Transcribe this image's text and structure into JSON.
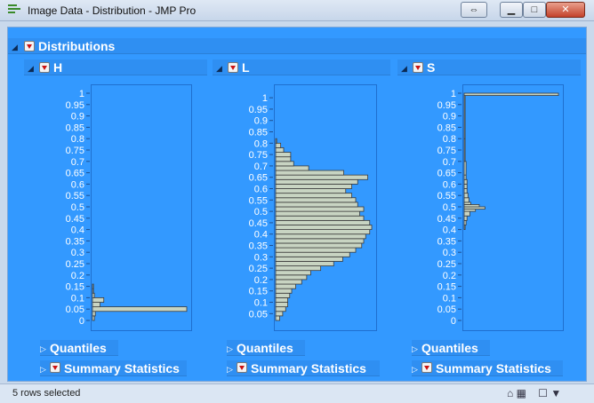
{
  "window": {
    "title": "Image Data - Distribution - JMP Pro",
    "buttons": {
      "back": "⇔",
      "minimize": "▁",
      "maximize": "□",
      "close": "✕"
    }
  },
  "report": {
    "title": "Distributions",
    "panels": [
      {
        "name": "H",
        "axis_ticks": [
          "1",
          "0.95",
          "0.9",
          "0.85",
          "0.8",
          "0.75",
          "0.7",
          "0.65",
          "0.6",
          "0.55",
          "0.5",
          "0.45",
          "0.4",
          "0.35",
          "0.3",
          "0.25",
          "0.2",
          "0.15",
          "0.1",
          "0.05",
          "0"
        ],
        "outline_quantiles": "Quantiles",
        "outline_summary": "Summary Statistics"
      },
      {
        "name": "L",
        "axis_ticks": [
          "1",
          "0.95",
          "0.9",
          "0.85",
          "0.8",
          "0.75",
          "0.7",
          "0.65",
          "0.6",
          "0.55",
          "0.5",
          "0.45",
          "0.4",
          "0.35",
          "0.3",
          "0.25",
          "0.2",
          "0.15",
          "0.1",
          "0.05"
        ],
        "outline_quantiles": "Quantiles",
        "outline_summary": "Summary Statistics"
      },
      {
        "name": "S",
        "axis_ticks": [
          "1",
          "0.95",
          "0.9",
          "0.85",
          "0.8",
          "0.75",
          "0.7",
          "0.65",
          "0.6",
          "0.55",
          "0.5",
          "0.45",
          "0.4",
          "0.35",
          "0.3",
          "0.25",
          "0.2",
          "0.15",
          "0.1",
          "0.05",
          "0"
        ],
        "outline_quantiles": "Quantiles",
        "outline_summary": "Summary Statistics"
      }
    ]
  },
  "chart_data": [
    {
      "type": "bar",
      "orientation": "horizontal-histogram",
      "title": "H",
      "bins": [
        {
          "from": 0.0,
          "to": 0.02,
          "count": 2
        },
        {
          "from": 0.02,
          "to": 0.04,
          "count": 3
        },
        {
          "from": 0.04,
          "to": 0.06,
          "count": 100
        },
        {
          "from": 0.06,
          "to": 0.08,
          "count": 8
        },
        {
          "from": 0.08,
          "to": 0.1,
          "count": 12
        },
        {
          "from": 0.1,
          "to": 0.12,
          "count": 2
        },
        {
          "from": 0.12,
          "to": 0.14,
          "count": 1
        },
        {
          "from": 0.14,
          "to": 0.16,
          "count": 1
        }
      ],
      "ylim": [
        0,
        1
      ]
    },
    {
      "type": "bar",
      "orientation": "horizontal-histogram",
      "title": "L",
      "bins": [
        {
          "from": 0.02,
          "to": 0.04,
          "count": 4
        },
        {
          "from": 0.04,
          "to": 0.06,
          "count": 7
        },
        {
          "from": 0.06,
          "to": 0.08,
          "count": 10
        },
        {
          "from": 0.08,
          "to": 0.1,
          "count": 12
        },
        {
          "from": 0.1,
          "to": 0.12,
          "count": 12
        },
        {
          "from": 0.12,
          "to": 0.14,
          "count": 14
        },
        {
          "from": 0.14,
          "to": 0.16,
          "count": 16
        },
        {
          "from": 0.16,
          "to": 0.18,
          "count": 20
        },
        {
          "from": 0.18,
          "to": 0.2,
          "count": 26
        },
        {
          "from": 0.2,
          "to": 0.22,
          "count": 31
        },
        {
          "from": 0.22,
          "to": 0.24,
          "count": 35
        },
        {
          "from": 0.24,
          "to": 0.26,
          "count": 45
        },
        {
          "from": 0.26,
          "to": 0.28,
          "count": 58
        },
        {
          "from": 0.28,
          "to": 0.3,
          "count": 67
        },
        {
          "from": 0.3,
          "to": 0.32,
          "count": 74
        },
        {
          "from": 0.32,
          "to": 0.34,
          "count": 80
        },
        {
          "from": 0.34,
          "to": 0.36,
          "count": 86
        },
        {
          "from": 0.36,
          "to": 0.38,
          "count": 88
        },
        {
          "from": 0.38,
          "to": 0.4,
          "count": 90
        },
        {
          "from": 0.4,
          "to": 0.42,
          "count": 94
        },
        {
          "from": 0.42,
          "to": 0.44,
          "count": 96
        },
        {
          "from": 0.44,
          "to": 0.46,
          "count": 94
        },
        {
          "from": 0.46,
          "to": 0.48,
          "count": 88
        },
        {
          "from": 0.48,
          "to": 0.5,
          "count": 84
        },
        {
          "from": 0.5,
          "to": 0.52,
          "count": 88
        },
        {
          "from": 0.52,
          "to": 0.54,
          "count": 82
        },
        {
          "from": 0.54,
          "to": 0.56,
          "count": 80
        },
        {
          "from": 0.56,
          "to": 0.58,
          "count": 76
        },
        {
          "from": 0.58,
          "to": 0.6,
          "count": 70
        },
        {
          "from": 0.6,
          "to": 0.62,
          "count": 76
        },
        {
          "from": 0.62,
          "to": 0.64,
          "count": 82
        },
        {
          "from": 0.64,
          "to": 0.66,
          "count": 92
        },
        {
          "from": 0.66,
          "to": 0.68,
          "count": 68
        },
        {
          "from": 0.68,
          "to": 0.7,
          "count": 33
        },
        {
          "from": 0.7,
          "to": 0.72,
          "count": 18
        },
        {
          "from": 0.72,
          "to": 0.74,
          "count": 15
        },
        {
          "from": 0.74,
          "to": 0.76,
          "count": 15
        },
        {
          "from": 0.76,
          "to": 0.78,
          "count": 8
        },
        {
          "from": 0.78,
          "to": 0.8,
          "count": 5
        },
        {
          "from": 0.8,
          "to": 0.82,
          "count": 1
        }
      ],
      "ylim": [
        0.02,
        1.02
      ]
    },
    {
      "type": "bar",
      "orientation": "horizontal-histogram",
      "title": "S",
      "bins": [
        {
          "from": 0.4,
          "to": 0.42,
          "count": 1
        },
        {
          "from": 0.42,
          "to": 0.44,
          "count": 2
        },
        {
          "from": 0.44,
          "to": 0.46,
          "count": 3
        },
        {
          "from": 0.46,
          "to": 0.48,
          "count": 6
        },
        {
          "from": 0.48,
          "to": 0.49,
          "count": 12
        },
        {
          "from": 0.49,
          "to": 0.5,
          "count": 22
        },
        {
          "from": 0.5,
          "to": 0.51,
          "count": 16
        },
        {
          "from": 0.51,
          "to": 0.52,
          "count": 7
        },
        {
          "from": 0.52,
          "to": 0.54,
          "count": 5
        },
        {
          "from": 0.54,
          "to": 0.56,
          "count": 4
        },
        {
          "from": 0.56,
          "to": 0.58,
          "count": 3
        },
        {
          "from": 0.58,
          "to": 0.6,
          "count": 3
        },
        {
          "from": 0.6,
          "to": 0.62,
          "count": 3
        },
        {
          "from": 0.62,
          "to": 0.64,
          "count": 2
        },
        {
          "from": 0.64,
          "to": 0.7,
          "count": 2
        },
        {
          "from": 0.7,
          "to": 0.8,
          "count": 1
        },
        {
          "from": 0.8,
          "to": 0.99,
          "count": 1
        },
        {
          "from": 0.99,
          "to": 1.0,
          "count": 100
        }
      ],
      "ylim": [
        0,
        1
      ]
    }
  ],
  "statusbar": {
    "text": "5 rows selected",
    "icons": [
      "home-icon",
      "table-icon",
      "checkbox-icon",
      "dropdown-arrow-icon"
    ]
  },
  "colors": {
    "report_background": "#3399ff",
    "bar_fill": "#c8d4c2",
    "bar_stroke": "#3a3a3a"
  }
}
